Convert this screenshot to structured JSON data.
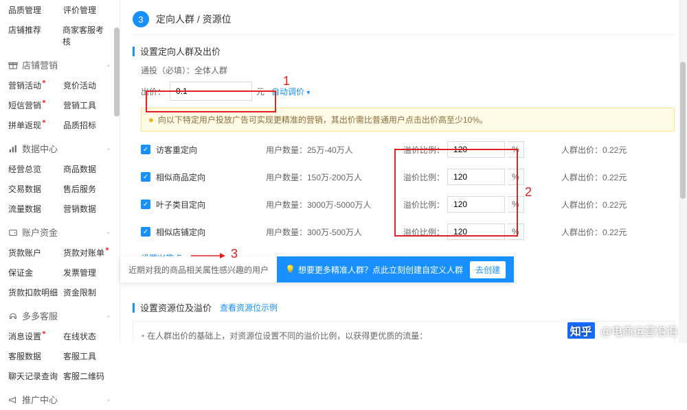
{
  "sidebar": {
    "top_links": [
      {
        "c1": "品质管理",
        "c2": "评价管理"
      },
      {
        "c1": "店铺推荐",
        "c2": "商家客服考核"
      }
    ],
    "groups": [
      {
        "title": "店铺营销",
        "items": [
          {
            "c1": "营销活动",
            "c1dot": true,
            "c2": "竞价活动"
          },
          {
            "c1": "短信营销",
            "c1dot": true,
            "c2": "营销工具"
          },
          {
            "c1": "拼单返现",
            "c1dot": true,
            "c2": "品质招标"
          }
        ]
      },
      {
        "title": "数据中心",
        "items": [
          {
            "c1": "经营总览",
            "c2": "商品数据"
          },
          {
            "c1": "交易数据",
            "c2": "售后服务"
          },
          {
            "c1": "流量数据",
            "c2": "营销数据"
          }
        ]
      },
      {
        "title": "账户资金",
        "items": [
          {
            "c1": "货款账户",
            "c2": "货款对账单",
            "c2dot": true
          },
          {
            "c1": "保证金",
            "c2": "发票管理"
          },
          {
            "c1": "货款扣款明细",
            "c2": "资金限制"
          }
        ]
      },
      {
        "title": "多多客服",
        "items": [
          {
            "c1": "消息设置",
            "c1dot": true,
            "c2": "在线状态"
          },
          {
            "c1": "客服数据",
            "c2": "客服工具"
          },
          {
            "c1": "聊天记录查询",
            "c2": "客服二维码"
          }
        ]
      },
      {
        "title": "推广中心",
        "items": []
      }
    ]
  },
  "step": {
    "num": "3",
    "title": "定向人群 / 资源位"
  },
  "section1": {
    "title": "设置定向人群及出价",
    "cast_line": "通投（必填）：全体人群",
    "bid_label": "出价：",
    "bid_value": "0.1",
    "bid_unit": "元",
    "auto_adjust": "自动调价",
    "notice": "向以下特定用户投放广告可实现更精准的营销，其出价需比普通用户点击出价高至少10%。",
    "user_count_label": "用户数量：",
    "premium_label": "溢价比例：",
    "crowd_bid_label": "人群出价：",
    "pct_sign": "%",
    "targets": [
      {
        "name": "访客重定向",
        "count": "25万-40万人",
        "pct": "120",
        "crowd": "0.22元"
      },
      {
        "name": "相似商品定向",
        "count": "150万-200万人",
        "pct": "120",
        "crowd": "0.22元"
      },
      {
        "name": "叶子类目定向",
        "count": "3000万-5000万人",
        "pct": "120",
        "crowd": "0.22元"
      },
      {
        "name": "相似店铺定向",
        "count": "300万-500万人",
        "pct": "120",
        "crowd": "0.22元"
      }
    ],
    "interest_link": "设置兴趣点"
  },
  "cta": {
    "hint": "近期对我的商品相关属性感兴趣的用户",
    "bulb_icon": "💡",
    "text": "想要更多精准人群？点此立刻创建自定义人群",
    "btn": "去创建"
  },
  "section2": {
    "title": "设置资源位及溢价",
    "link": "查看资源位示例",
    "desc": "在人群出价的基础上，对资源位设置不同的溢价比例，以获得更优质的流量："
  },
  "annotations": {
    "n1": "1",
    "n2": "2",
    "n3": "3"
  },
  "watermark": {
    "logo_text": "知乎",
    "user": "@电商运营泡泡"
  }
}
